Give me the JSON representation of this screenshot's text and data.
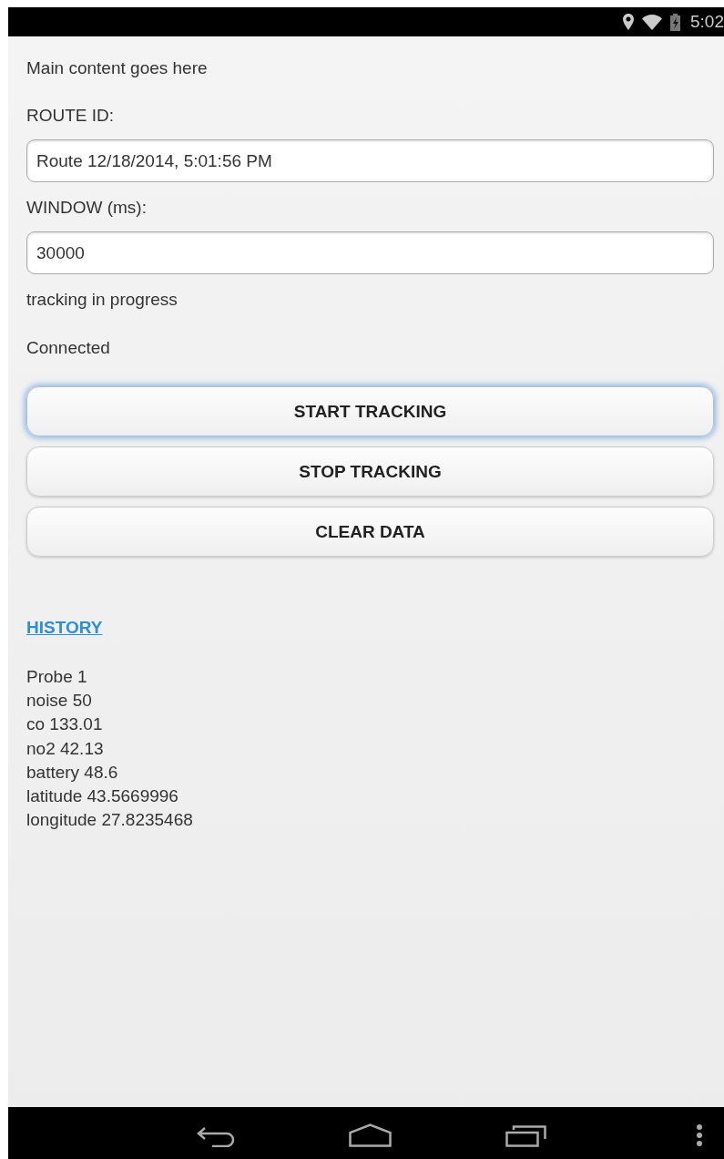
{
  "status_bar": {
    "time": "5:02"
  },
  "intro": "Main content goes here",
  "fields": [
    {
      "label": "ROUTE ID:",
      "value": "Route 12/18/2014, 5:01:56 PM"
    },
    {
      "label": "WINDOW (ms):",
      "value": "30000"
    }
  ],
  "status_lines": [
    "tracking in progress",
    "Connected"
  ],
  "buttons": [
    {
      "label": "START TRACKING",
      "focused": true
    },
    {
      "label": "STOP TRACKING",
      "focused": false
    },
    {
      "label": "CLEAR DATA",
      "focused": false
    }
  ],
  "history_link": "HISTORY",
  "history": [
    "Probe 1",
    "noise 50",
    "co 133.01",
    "no2 42.13",
    "battery 48.6",
    "latitude 43.5669996",
    "longitude 27.8235468"
  ]
}
